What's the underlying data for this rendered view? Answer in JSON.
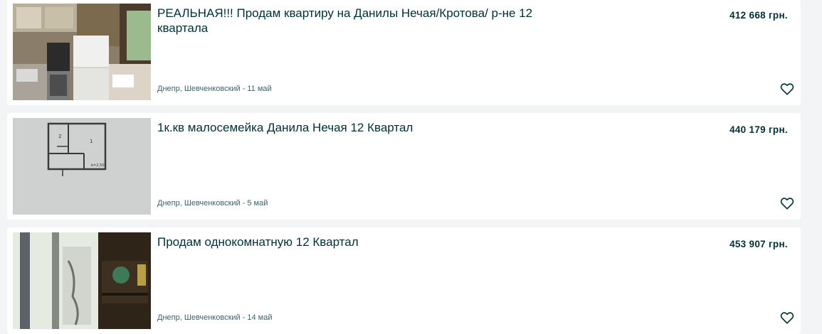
{
  "listings": [
    {
      "title": "РЕАЛЬНАЯ!!! Продам квартиру на Данилы Нечая/Кротова/ р-не 12 квартала",
      "price": "412 668 грн.",
      "location": "Днепр, Шевченковский",
      "date": "11 май",
      "separator": "-",
      "image": "kitchen-photo"
    },
    {
      "title": "1к.кв малосемейка Данила Нечая 12 Квартал",
      "price": "440 179 грн.",
      "location": "Днепр, Шевченковский",
      "date": "5 май",
      "separator": "-",
      "image": "floor-plan-photo"
    },
    {
      "title": "Продам однокомнатную 12 Квартал",
      "price": "453 907 грн.",
      "location": "Днепр, Шевченковский",
      "date": "14 май",
      "separator": "-",
      "image": "room-window-photo"
    }
  ],
  "icons": {
    "favorite": "heart-outline-icon"
  },
  "colors": {
    "text_primary": "#002f34",
    "text_meta": "#406367",
    "background": "#f2f4f5",
    "card": "#ffffff"
  }
}
